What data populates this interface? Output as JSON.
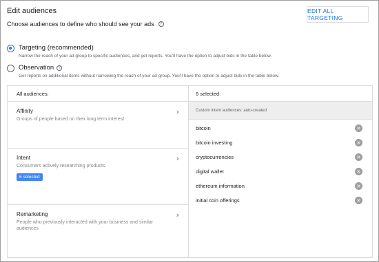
{
  "header": {
    "title": "Edit audiences",
    "subtitle": "Choose audiences to define who should see your ads",
    "help_icon": "?",
    "edit_button": "EDIT ALL TARGETING"
  },
  "options": [
    {
      "label": "Targeting (recommended)",
      "description": "Narrow the reach of your ad group to specific audiences, and get reports. You'll have the option to adjust bids in the table below.",
      "checked": true
    },
    {
      "label": "Observation",
      "description": "Get reports on additional items without narrowing the reach of your ad group. You'll have the option to adjust bids in the table below.",
      "checked": false
    }
  ],
  "left_panel": {
    "header": "All audiences:",
    "categories": [
      {
        "title": "Affinity",
        "description": "Groups of people based on their long term interest"
      },
      {
        "title": "Intent",
        "description": "Consumers actively researching products",
        "badge": "6 selected"
      },
      {
        "title": "Remarketing",
        "description": "People who previously interacted with your business and similar audiences"
      }
    ],
    "chevron": "›"
  },
  "right_panel": {
    "header": "6 selected",
    "group_label": "Custom intent audiences: auto-created",
    "items": [
      "bitcoin",
      "bitcoin investing",
      "cryptocurrencies",
      "digital wallet",
      "ethereum information",
      "initial coin offerings"
    ],
    "remove_glyph": "×"
  },
  "colors": {
    "accent": "#1a73e8",
    "badge": "#4285f4",
    "remove_icon": "#9e9e9e"
  }
}
